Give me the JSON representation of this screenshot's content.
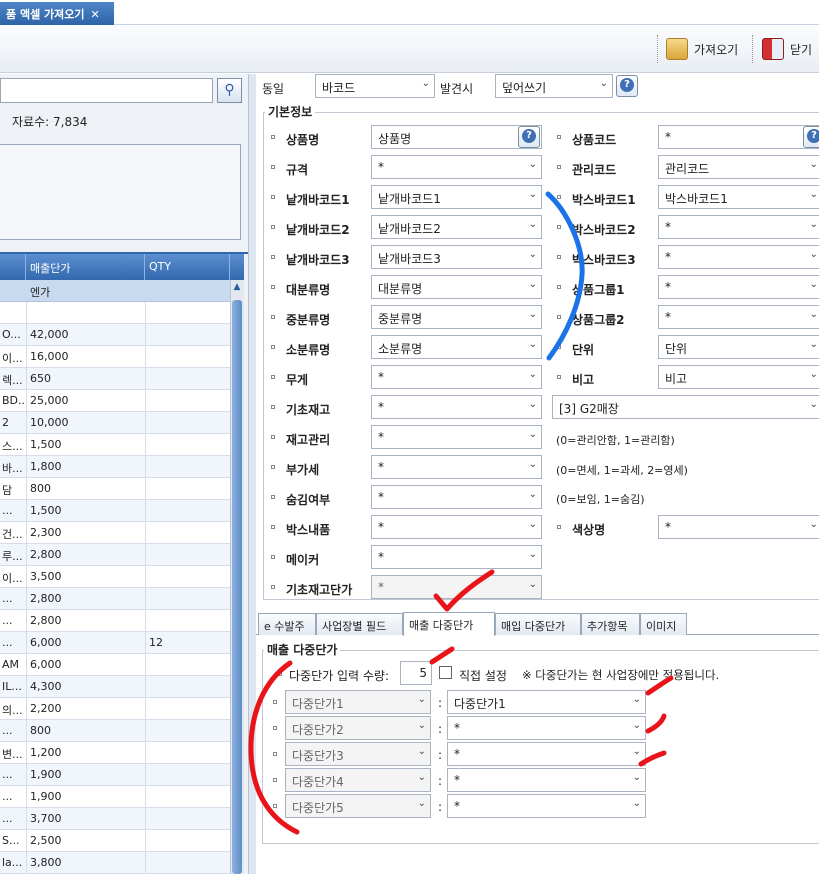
{
  "tab": {
    "title": "품 액셀 가져오기",
    "close": "✕"
  },
  "toolbar": {
    "import_label": "가져오기",
    "close_label": "닫기"
  },
  "left": {
    "count_label": "자료수:",
    "count_value": "7,834"
  },
  "grid": {
    "columns": [
      "매출단가",
      "QTY"
    ],
    "filter_row": [
      "",
      "엔가"
    ],
    "rows": [
      {
        "a": "",
        "b": "",
        "c": ""
      },
      {
        "a": "O...",
        "b": "42,000",
        "c": ""
      },
      {
        "a": "이...",
        "b": "16,000",
        "c": ""
      },
      {
        "a": "렉...",
        "b": "650",
        "c": ""
      },
      {
        "a": "BD...",
        "b": "25,000",
        "c": ""
      },
      {
        "a": "2",
        "b": "10,000",
        "c": ""
      },
      {
        "a": "스...",
        "b": "1,500",
        "c": ""
      },
      {
        "a": "바...",
        "b": "1,800",
        "c": ""
      },
      {
        "a": "담",
        "b": "800",
        "c": ""
      },
      {
        "a": "...",
        "b": "1,500",
        "c": ""
      },
      {
        "a": "건...",
        "b": "2,300",
        "c": ""
      },
      {
        "a": "루...",
        "b": "2,800",
        "c": ""
      },
      {
        "a": "이...",
        "b": "3,500",
        "c": ""
      },
      {
        "a": "...",
        "b": "2,800",
        "c": ""
      },
      {
        "a": "...",
        "b": "2,800",
        "c": ""
      },
      {
        "a": "...",
        "b": "6,000",
        "c": "12"
      },
      {
        "a": "AM",
        "b": "6,000",
        "c": ""
      },
      {
        "a": "IL...",
        "b": "4,300",
        "c": ""
      },
      {
        "a": "의...",
        "b": "2,200",
        "c": ""
      },
      {
        "a": "...",
        "b": "800",
        "c": ""
      },
      {
        "a": "변...",
        "b": "1,200",
        "c": ""
      },
      {
        "a": "...",
        "b": "1,900",
        "c": ""
      },
      {
        "a": "...",
        "b": "1,900",
        "c": ""
      },
      {
        "a": "...",
        "b": "3,700",
        "c": ""
      },
      {
        "a": "S...",
        "b": "2,500",
        "c": ""
      },
      {
        "a": "la...",
        "b": "3,800",
        "c": ""
      }
    ]
  },
  "top": {
    "same_label": "동일",
    "same_value": "바코드",
    "found_label": "발견시",
    "found_value": "덮어쓰기"
  },
  "basic": {
    "title": "기본정보",
    "left_fields": [
      {
        "label": "상품명",
        "value": "상품명"
      },
      {
        "label": "규격",
        "value": "*"
      },
      {
        "label": "낱개바코드1",
        "value": "낱개바코드1"
      },
      {
        "label": "낱개바코드2",
        "value": "낱개바코드2"
      },
      {
        "label": "낱개바코드3",
        "value": "낱개바코드3"
      },
      {
        "label": "대분류명",
        "value": "대분류명"
      },
      {
        "label": "중분류명",
        "value": "중분류명"
      },
      {
        "label": "소분류명",
        "value": "소분류명"
      },
      {
        "label": "무게",
        "value": "*"
      },
      {
        "label": "기초재고",
        "value": "*"
      },
      {
        "label": "재고관리",
        "value": "*"
      },
      {
        "label": "부가세",
        "value": "*"
      },
      {
        "label": "숨김여부",
        "value": "*"
      },
      {
        "label": "박스내품",
        "value": "*"
      },
      {
        "label": "메이커",
        "value": "*"
      },
      {
        "label": "기초재고단가",
        "value": "*"
      }
    ],
    "right_fields": [
      {
        "label": "상품코드",
        "value": "*"
      },
      {
        "label": "관리코드",
        "value": "관리코드"
      },
      {
        "label": "박스바코드1",
        "value": "박스바코드1"
      },
      {
        "label": "박스바코드2",
        "value": "*"
      },
      {
        "label": "박스바코드3",
        "value": "*"
      },
      {
        "label": "상품그룹1",
        "value": "*"
      },
      {
        "label": "상품그룹2",
        "value": "*"
      },
      {
        "label": "단위",
        "value": "단위"
      },
      {
        "label": "비고",
        "value": "비고"
      }
    ],
    "store_value": "[3] G2매장",
    "hint_stock": "(0=관리안함, 1=관리함)",
    "hint_vat": "(0=면세, 1=과세, 2=영세)",
    "hint_hide": "(0=보임, 1=숨김)",
    "color_label": "색상명",
    "color_value": "*"
  },
  "tabs": [
    "e 수발주",
    "사업장별 필드",
    "매출 다중단가",
    "매입 다중단가",
    "추가항목",
    "이미지"
  ],
  "price": {
    "title": "매출 다중단가",
    "qty_label": "다중단가 입력 수량:",
    "qty_value": "5",
    "direct_label": "직접 설정",
    "note": "※ 다중단가는 현 사업장에만 적용됩니다.",
    "rows": [
      {
        "label": "다중단가1",
        "value": "다중단가1"
      },
      {
        "label": "다중단가2",
        "value": "*"
      },
      {
        "label": "다중단가3",
        "value": "*"
      },
      {
        "label": "다중단가4",
        "value": "*"
      },
      {
        "label": "다중단가5",
        "value": "*"
      }
    ]
  },
  "colors": {
    "blue_mark": "#1a73e8",
    "red_mark": "#e8141a"
  }
}
